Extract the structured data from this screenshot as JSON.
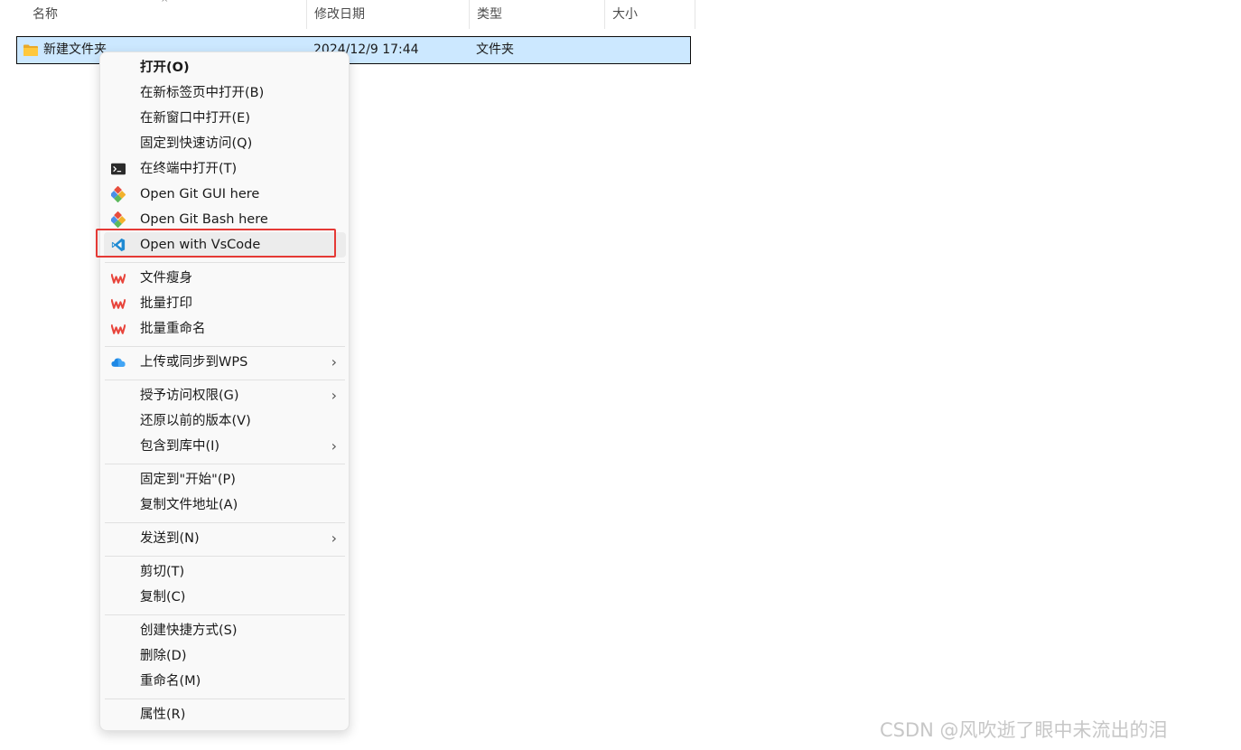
{
  "columns": {
    "name": "名称",
    "modified": "修改日期",
    "type": "类型",
    "size": "大小"
  },
  "file": {
    "name": "新建文件夹",
    "modified": "2024/12/9 17:44",
    "type": "文件夹",
    "icon": "folder-icon"
  },
  "menu": {
    "items": [
      {
        "label": "打开(O)",
        "icon": ""
      },
      {
        "label": "在新标签页中打开(B)",
        "icon": ""
      },
      {
        "label": "在新窗口中打开(E)",
        "icon": ""
      },
      {
        "label": "固定到快速访问(Q)",
        "icon": ""
      },
      {
        "label": "在终端中打开(T)",
        "icon": "terminal-icon"
      },
      {
        "label": "Open Git GUI here",
        "icon": "git-gui-icon"
      },
      {
        "label": "Open Git Bash here",
        "icon": "git-bash-icon"
      },
      {
        "label": "Open with VsCode",
        "icon": "vscode-icon"
      },
      {
        "label": "文件瘦身",
        "icon": "wps-icon"
      },
      {
        "label": "批量打印",
        "icon": "wps-icon"
      },
      {
        "label": "批量重命名",
        "icon": "wps-icon"
      },
      {
        "label": "上传或同步到WPS",
        "icon": "cloud-icon"
      },
      {
        "label": "授予访问权限(G)",
        "icon": ""
      },
      {
        "label": "还原以前的版本(V)",
        "icon": ""
      },
      {
        "label": "包含到库中(I)",
        "icon": ""
      },
      {
        "label": "固定到\"开始\"(P)",
        "icon": ""
      },
      {
        "label": "复制文件地址(A)",
        "icon": ""
      },
      {
        "label": "发送到(N)",
        "icon": ""
      },
      {
        "label": "剪切(T)",
        "icon": ""
      },
      {
        "label": "复制(C)",
        "icon": ""
      },
      {
        "label": "创建快捷方式(S)",
        "icon": ""
      },
      {
        "label": "删除(D)",
        "icon": ""
      },
      {
        "label": "重命名(M)",
        "icon": ""
      },
      {
        "label": "属性(R)",
        "icon": ""
      }
    ]
  },
  "watermark": "CSDN @风吹逝了眼中未流出的泪",
  "colors": {
    "selection": "#cce8ff",
    "highlight_border": "#e53935",
    "menu_bg": "#f9f9f9",
    "wps_red": "#e8453c",
    "vscode_blue": "#1f8ad2"
  }
}
